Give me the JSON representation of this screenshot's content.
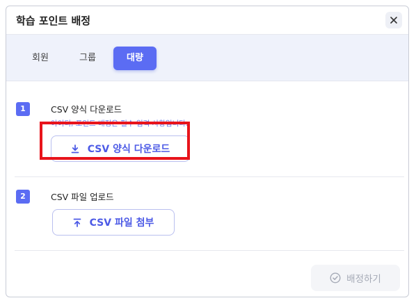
{
  "dialog": {
    "title": "학습 포인트 배정",
    "close_icon": "close-icon"
  },
  "tabs": [
    {
      "label": "회원",
      "active": false
    },
    {
      "label": "그룹",
      "active": false
    },
    {
      "label": "대량",
      "active": true
    }
  ],
  "steps": [
    {
      "number": "1",
      "title": "CSV 양식 다운로드",
      "notice": "아이디, 포인트 배정은 필수 입력 사항입니다.",
      "button_label": "CSV 양식 다운로드",
      "button_icon": "download-icon"
    },
    {
      "number": "2",
      "title": "CSV 파일 업로드",
      "button_label": "CSV 파일 첨부",
      "button_icon": "upload-icon"
    }
  ],
  "submit": {
    "label": "배정하기",
    "icon": "check-circle-icon",
    "disabled": true
  },
  "colors": {
    "accent": "#5b6cf3",
    "notice_text": "#6a79f0",
    "highlight_border": "#e8141b",
    "tabs_background": "#eff2fb"
  }
}
